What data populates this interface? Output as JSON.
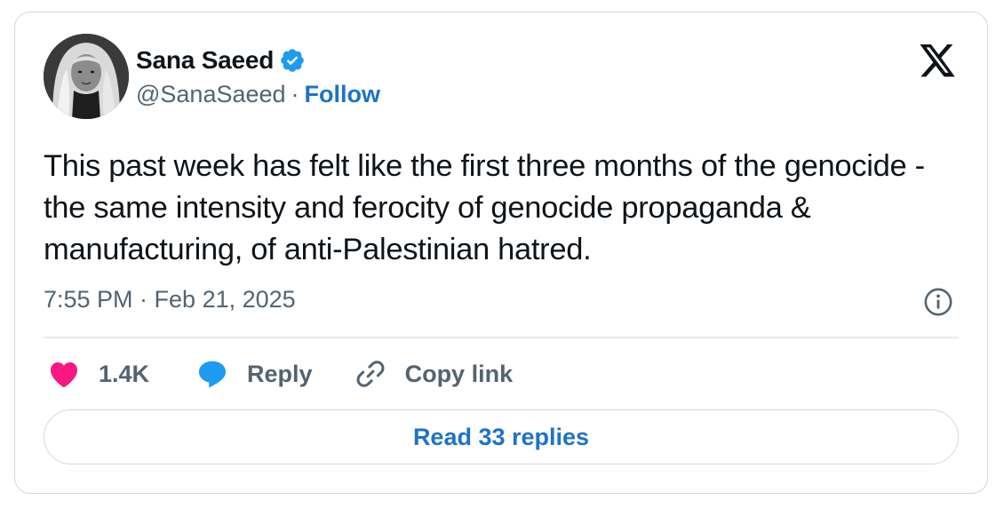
{
  "author": {
    "display_name": "Sana Saeed",
    "handle": "@SanaSaeed",
    "separator": "·",
    "follow_label": "Follow"
  },
  "tweet": {
    "text": "This past week has felt like the first three months of the genocide - the same intensity and ferocity of genocide propaganda & manufacturing, of anti-Palestinian hatred.",
    "timestamp": "7:55 PM · Feb 21, 2025"
  },
  "actions": {
    "likes_count": "1.4K",
    "reply_label": "Reply",
    "copy_link_label": "Copy link"
  },
  "read_replies_label": "Read 33 replies",
  "icons": {
    "verified": "verified-badge-icon",
    "platform": "x-logo-icon",
    "info": "info-icon",
    "like": "heart-icon",
    "reply": "speech-bubble-icon",
    "copy": "link-icon"
  },
  "colors": {
    "accent_blue": "#1d73c9",
    "verified_blue": "#1d9bf0",
    "like_pink": "#f91880",
    "text_primary": "#0f1419",
    "text_secondary": "#536471",
    "border": "#cfd9de"
  }
}
